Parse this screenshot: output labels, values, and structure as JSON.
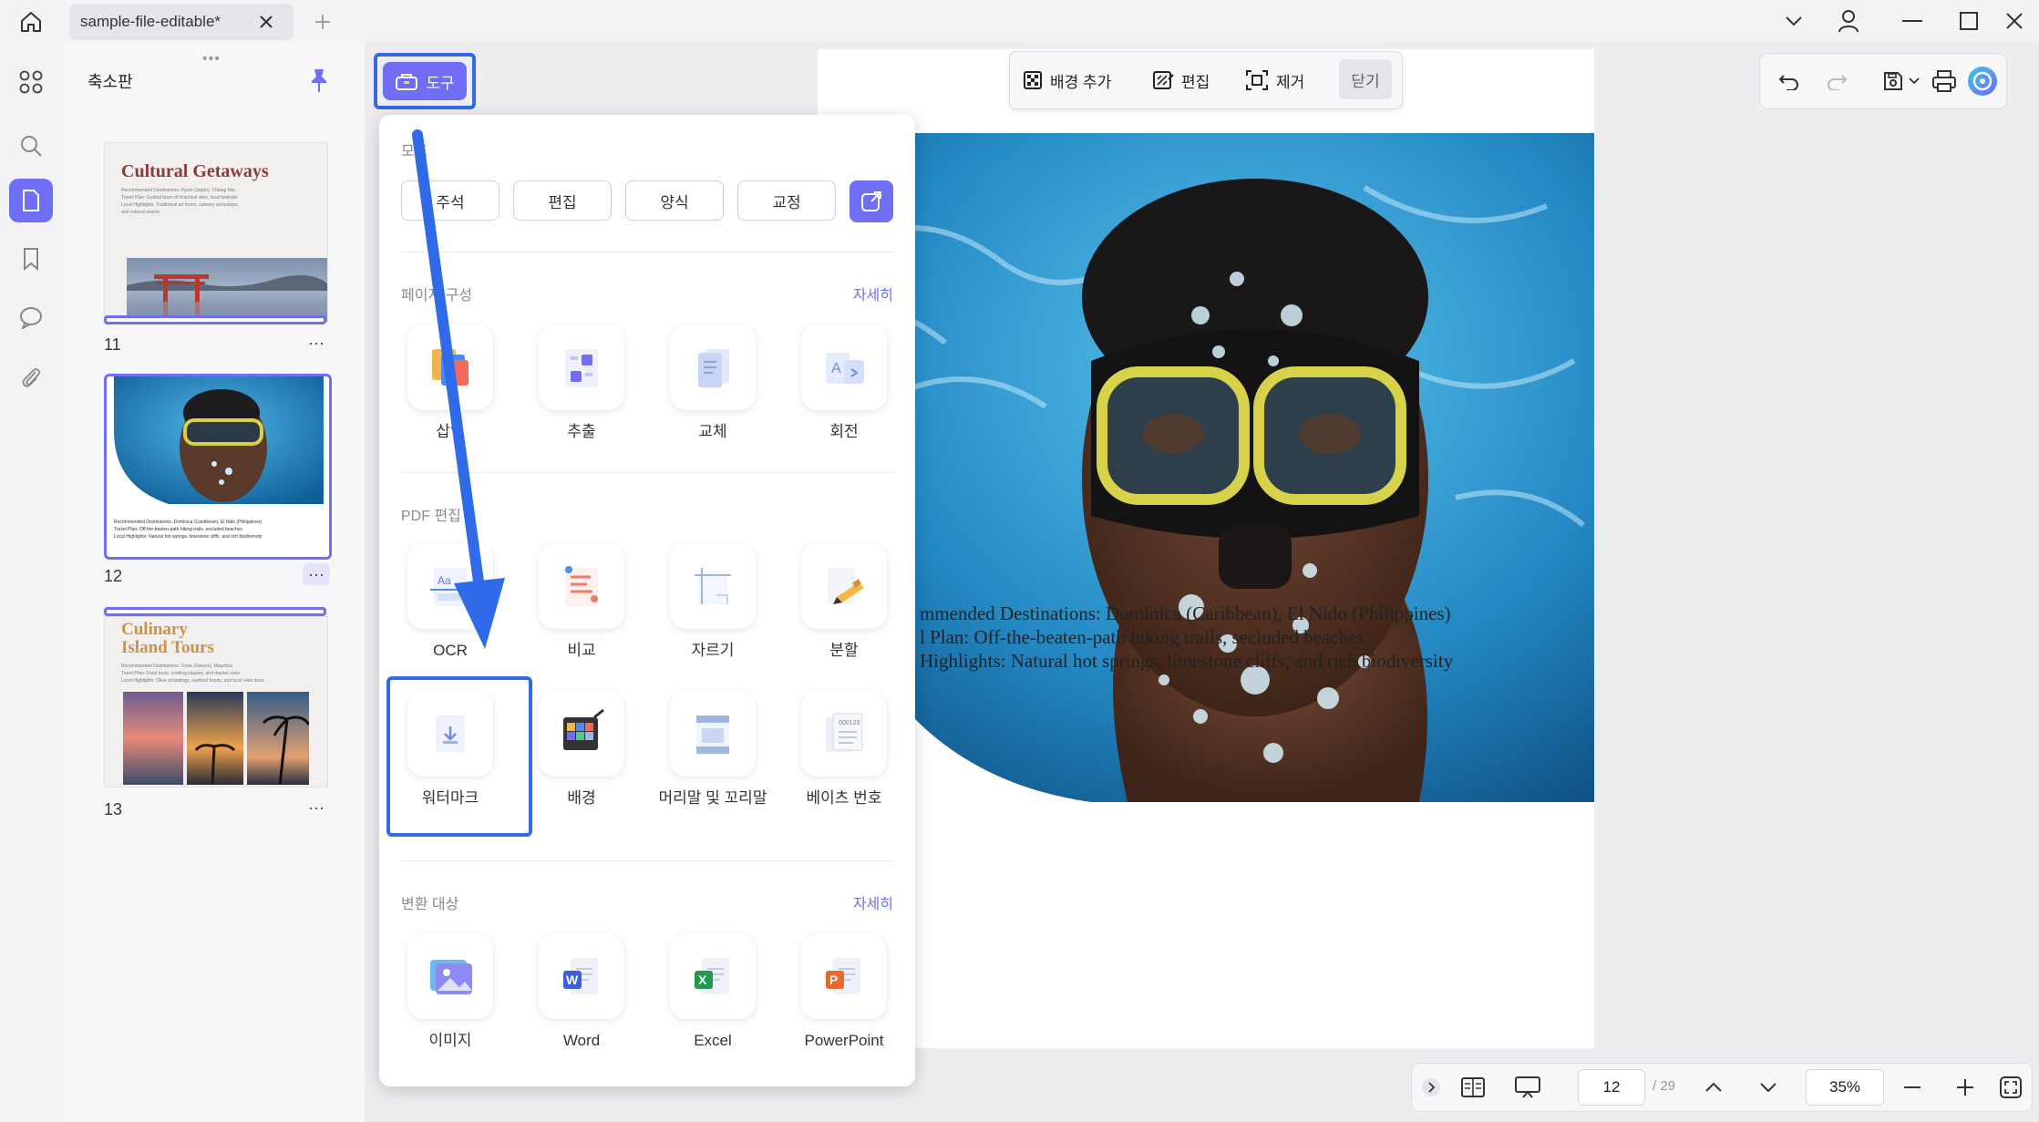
{
  "titlebar": {
    "tab_title": "sample-file-editable*",
    "close_tab": "✕",
    "new_tab": "+"
  },
  "thumbnails": {
    "panel_title": "축소판",
    "pages": [
      {
        "number": "11",
        "heading": "Cultural Getaways",
        "line1": "Recommended Destinations: Kyoto (Japan), Chiang Mai",
        "line2": "Travel Plan: Guided tours of historical sites, local festivals",
        "line3": "Local Highlights: Traditional art forms, culinary workshops,",
        "line4": "and cultural events",
        "more": "···"
      },
      {
        "number": "12",
        "line1": "Recommended Destinations: Dominica (Caribbean), El Nido (Philippines)",
        "line2": "Travel Plan: Off-the-beaten-path hiking trails, secluded beaches",
        "line3": "Local Highlights: Natural hot springs, limestone cliffs, and rich biodiversity",
        "more": "···"
      },
      {
        "number": "13",
        "heading_a": "Culinary",
        "heading_b": "Island Tours",
        "line1": "Recommended Destinations: Crete (Greece), Mauritius",
        "line2": "Travel Plan: Food tours, cooking classes, and market visits",
        "line3": "Local Highlights: Olive oil tastings, seafood feasts, and local wine tours",
        "more": "···"
      }
    ]
  },
  "tool_button": {
    "label": "도구"
  },
  "tools_panel": {
    "all_label": "모드",
    "categories": [
      "주석",
      "편집",
      "양식",
      "교정"
    ],
    "sections": {
      "page_org": {
        "label": "페이지 구성",
        "more": "자세히",
        "items": [
          "삽입",
          "추출",
          "교체",
          "회전"
        ]
      },
      "pdf_edit": {
        "label": "PDF 편집",
        "items_row1": [
          "OCR",
          "비교",
          "자르기",
          "분할"
        ],
        "items_row2": [
          "워터마크",
          "배경",
          "머리말 및 꼬리말",
          "베이츠 번호"
        ]
      },
      "convert": {
        "label": "변환 대상",
        "more": "자세히",
        "items": [
          "이미지",
          "Word",
          "Excel",
          "PowerPoint"
        ]
      }
    }
  },
  "background_toolbar": {
    "add_background": "배경 추가",
    "edit": "편집",
    "remove": "제거",
    "close": "닫기"
  },
  "document": {
    "lines": [
      "mmended Destinations: Dominica (Caribbean), El Nido (Philippines)",
      "l Plan: Off-the-beaten-path hiking trails, secluded beaches",
      " Highlights: Natural hot springs, limestone cliffs, and rich biodiversity"
    ]
  },
  "bottom_nav": {
    "current_page": "12",
    "total_pages": "/ 29",
    "zoom": "35%"
  },
  "colors": {
    "accent": "#6f6ef4",
    "highlight_blue": "#2f6be8",
    "background": "#ededf0"
  }
}
